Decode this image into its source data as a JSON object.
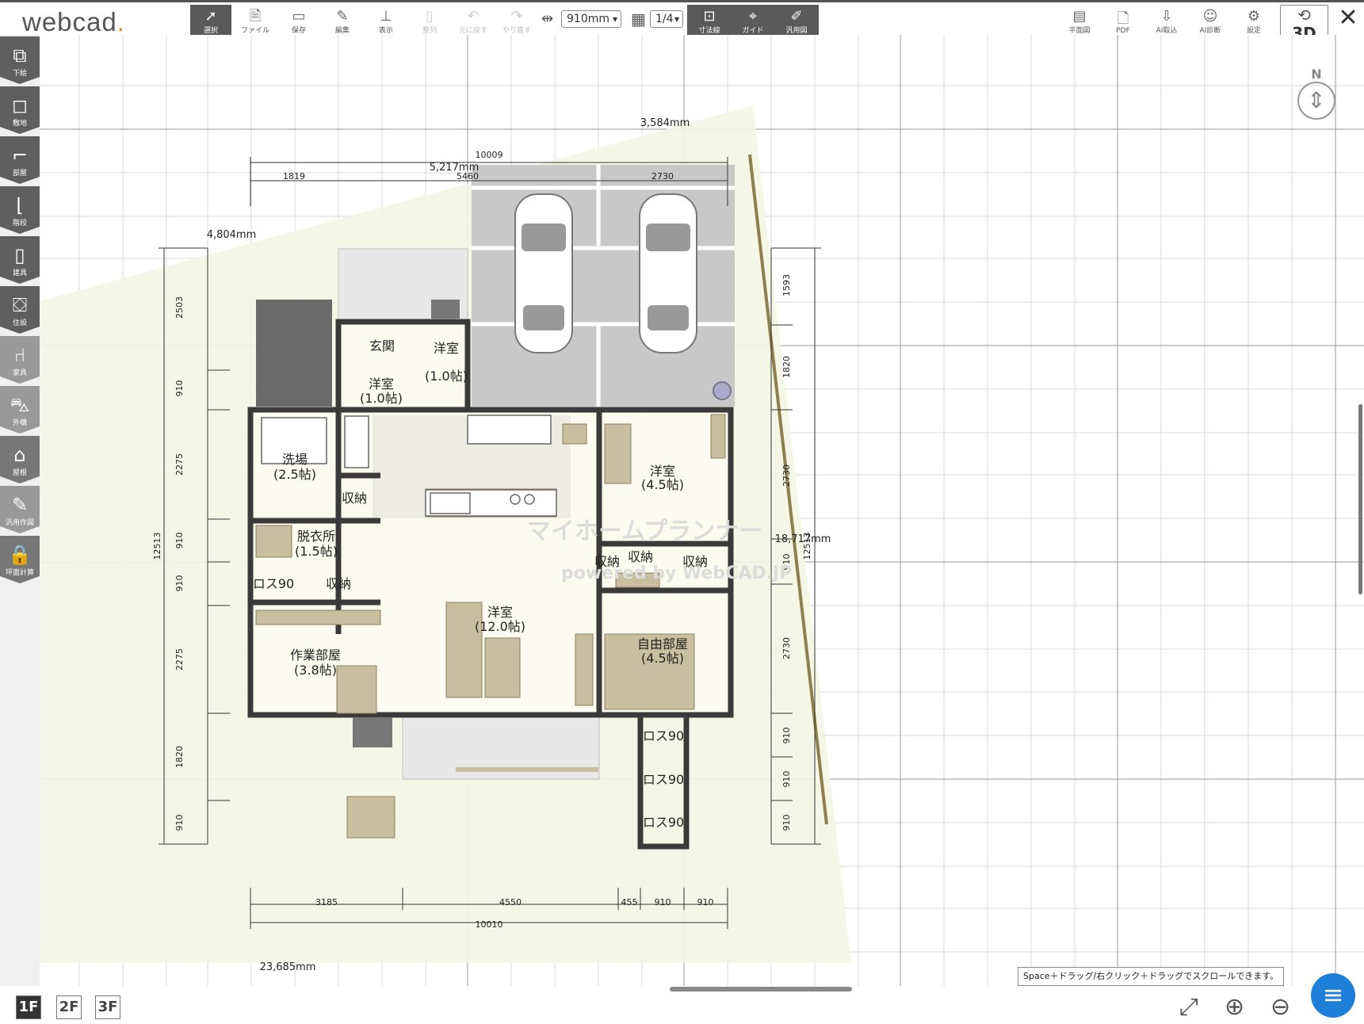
{
  "app": {
    "logo_text": "webcad",
    "logo_dot": "."
  },
  "toolbar": {
    "items": [
      {
        "icon": "cursor-icon",
        "label": "選択",
        "state": "active"
      },
      {
        "icon": "file-icon",
        "label": "ファイル"
      },
      {
        "icon": "folder-icon",
        "label": "保存"
      },
      {
        "icon": "edit-icon",
        "label": "編集"
      },
      {
        "icon": "ruler-icon",
        "label": "表示"
      },
      {
        "icon": "align-icon",
        "label": "整列",
        "state": "disabled"
      },
      {
        "icon": "undo-icon",
        "label": "元に戻す",
        "state": "disabled"
      },
      {
        "icon": "redo-icon",
        "label": "やり直す",
        "state": "disabled"
      }
    ],
    "grid_size": "910mm",
    "grid_fraction": "1/4",
    "mode_items": [
      {
        "icon": "dimension-icon",
        "label": "寸法線"
      },
      {
        "icon": "guide-icon",
        "label": "ガイド"
      },
      {
        "icon": "general-drawing-icon",
        "label": "汎用図"
      }
    ],
    "right_items": [
      {
        "icon": "floorplan-icon",
        "label": "平面図"
      },
      {
        "icon": "pdf-icon",
        "label": "PDF"
      },
      {
        "icon": "ai-import-icon",
        "label": "AI取込"
      },
      {
        "icon": "ai-diagnosis-icon",
        "label": "AI診断"
      },
      {
        "icon": "settings-icon",
        "label": "設定"
      }
    ],
    "view3d_label": "3D"
  },
  "sidebar": {
    "items": [
      {
        "icon": "underlay-icon",
        "label": "下絵"
      },
      {
        "icon": "site-icon",
        "label": "敷地"
      },
      {
        "icon": "room-icon",
        "label": "部屋"
      },
      {
        "icon": "stairs-icon",
        "label": "階段"
      },
      {
        "icon": "door-icon",
        "label": "建具"
      },
      {
        "icon": "bathtub-icon",
        "label": "住設"
      },
      {
        "icon": "chair-icon",
        "label": "家具"
      },
      {
        "icon": "car-icon",
        "label": "外構"
      },
      {
        "icon": "lock-house-icon",
        "label": "屋根"
      },
      {
        "icon": "abc-draw-icon",
        "label": "汎用作図"
      },
      {
        "icon": "lock-icon",
        "label": "坪面計算"
      }
    ]
  },
  "compass": {
    "label": "N"
  },
  "plan": {
    "site_dims": {
      "top": "3,584mm",
      "left": "4,804mm",
      "right": "18,717mm",
      "bottom": "23,685mm",
      "inner": "5,217mm"
    },
    "top_dims": {
      "total": "10009",
      "segments": [
        "1819",
        "5460",
        "2730"
      ]
    },
    "bottom_dims": {
      "total": "10010",
      "segments": [
        "3185",
        "4550",
        "455",
        "910",
        "910"
      ]
    },
    "left_dims": {
      "total": "12513",
      "segments": [
        "2503",
        "910",
        "2275",
        "910",
        "910",
        "2275",
        "1820",
        "910"
      ]
    },
    "right_dims": {
      "total": "12513",
      "segments": [
        "1593",
        "1820",
        "2730",
        "910",
        "2730",
        "910",
        "910",
        "910"
      ]
    },
    "rooms": [
      {
        "name": "玄関",
        "size": ""
      },
      {
        "name": "洋室",
        "size": "(1.0帖)"
      },
      {
        "name": "洋室",
        "size": "(1.0帖)"
      },
      {
        "name": "洗場",
        "size": "(2.5帖)"
      },
      {
        "name": "収納",
        "size": ""
      },
      {
        "name": "脱衣所",
        "size": "(1.5帖)"
      },
      {
        "name": "ロス90",
        "size": ""
      },
      {
        "name": "収納",
        "size": ""
      },
      {
        "name": "作業部屋",
        "size": "(3.8帖)"
      },
      {
        "name": "洋室",
        "size": "(12.0帖)"
      },
      {
        "name": "洋室",
        "size": "(4.5帖)"
      },
      {
        "name": "収納",
        "size": ""
      },
      {
        "name": "収納",
        "size": ""
      },
      {
        "name": "収納",
        "size": ""
      },
      {
        "name": "自由部屋",
        "size": "(4.5帖)"
      },
      {
        "name": "ロス90",
        "size": ""
      },
      {
        "name": "ロス90",
        "size": ""
      },
      {
        "name": "ロス90",
        "size": ""
      }
    ],
    "watermark_line1": "マイホームプランナー",
    "watermark_line2": "powered by WebCAD.JP"
  },
  "floors": [
    "1F",
    "2F",
    "3F"
  ],
  "hint": "Space＋ドラッグ/右クリック＋ドラッグでスクロールできます。",
  "colors": {
    "site": "#f4f6e4",
    "wall": "#3a3a3a",
    "floor": "#fbfbf0",
    "garage": "#c8c8c8",
    "accent": "#1e7fd8"
  }
}
